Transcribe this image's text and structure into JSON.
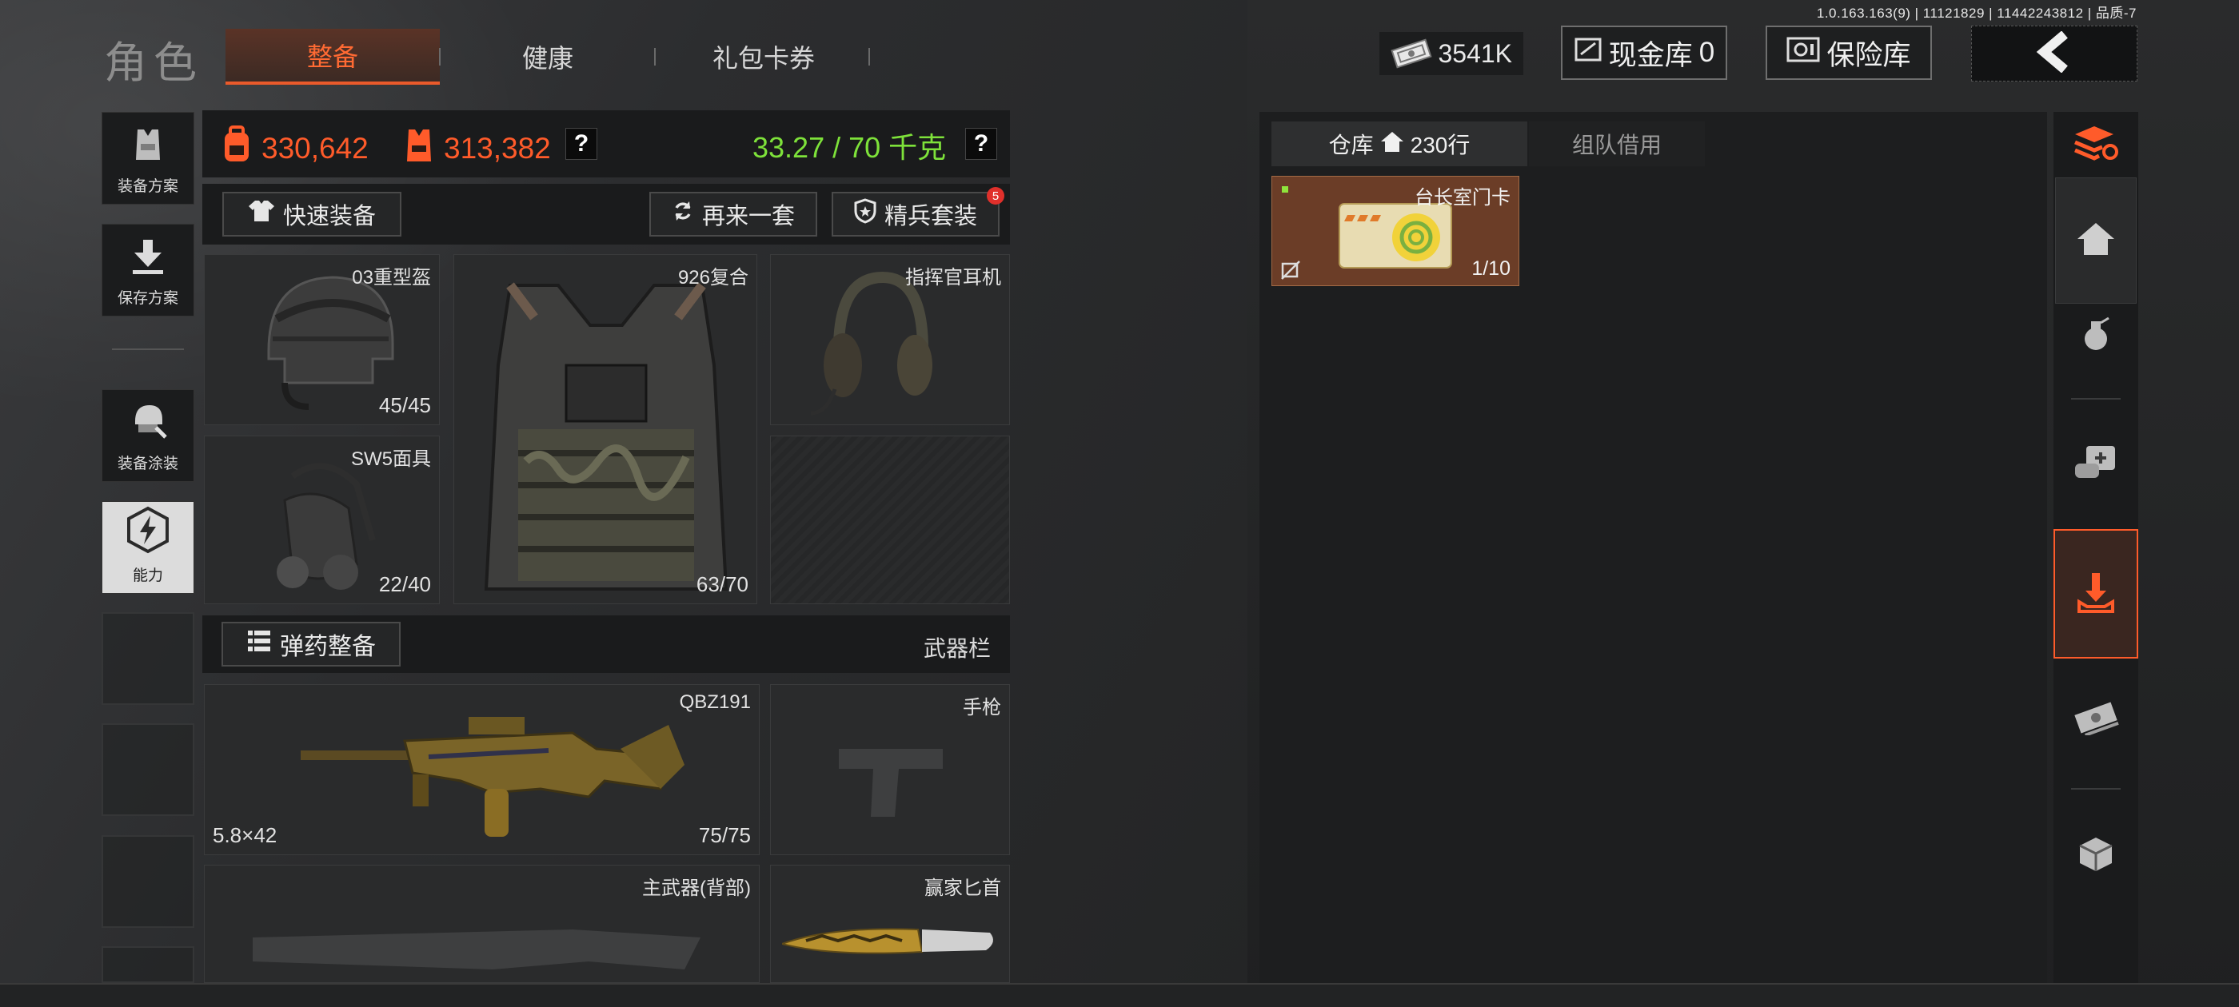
{
  "version_info": "1.0.163.163(9) | 11121829 | 11442243812 | 品质-7",
  "header": {
    "title": "角色",
    "tabs": [
      {
        "label": "整备",
        "active": true
      },
      {
        "label": "健康",
        "active": false
      },
      {
        "label": "礼包卡券",
        "active": false
      }
    ],
    "money": "3541K",
    "cash_vault_label": "现金库",
    "cash_vault_count": "0",
    "safe_label": "保险库",
    "back_icon": "chevron-left-icon"
  },
  "left_sidebar": [
    {
      "label": "装备方案",
      "icon": "vest-icon"
    },
    {
      "label": "保存方案",
      "icon": "download-icon"
    },
    {
      "label": "装备涂装",
      "icon": "helmet-paint-icon"
    },
    {
      "label": "能力",
      "icon": "lightning-badge-icon"
    }
  ],
  "stats": {
    "backpack_value": "330,642",
    "vest_value": "313,382",
    "q1": "?",
    "weight": "33.27 / 70 千克",
    "q2": "?"
  },
  "toolbar": {
    "quick_equip": "快速装备",
    "again": "再来一套",
    "elite": "精兵套装",
    "elite_badge": "5"
  },
  "gear": {
    "helmet": {
      "name": "03重型盔",
      "durability": "45/45"
    },
    "armor": {
      "name": "926复合",
      "durability": "63/70"
    },
    "headset": {
      "name": "指挥官耳机"
    },
    "mask": {
      "name": "SW5面具",
      "durability": "22/40"
    }
  },
  "ammo_bar": {
    "button": "弹药整备",
    "label": "武器栏"
  },
  "weapons": {
    "primary": {
      "name": "QBZ191",
      "caliber": "5.8×42",
      "durability": "75/75"
    },
    "pistol": {
      "name": "手枪"
    },
    "back": {
      "name": "主武器(背部)"
    },
    "melee": {
      "name": "赢家匕首"
    }
  },
  "warehouse": {
    "tabs": [
      {
        "label": "仓库",
        "active": true
      },
      {
        "label": "组队借用",
        "active": false
      }
    ],
    "row_count": "230行",
    "items": [
      {
        "name": "台长室门卡",
        "count": "1/10"
      }
    ]
  },
  "right_sidebar": [
    "layers-refresh-icon",
    "home-icon",
    "grenade-icon",
    "medkit-icon",
    "hand-download-icon",
    "cash-icon",
    "box-icon"
  ],
  "colors": {
    "accent": "#ff5b2a",
    "weight_green": "#7ee23a",
    "card_brown": "#6b3d27"
  }
}
